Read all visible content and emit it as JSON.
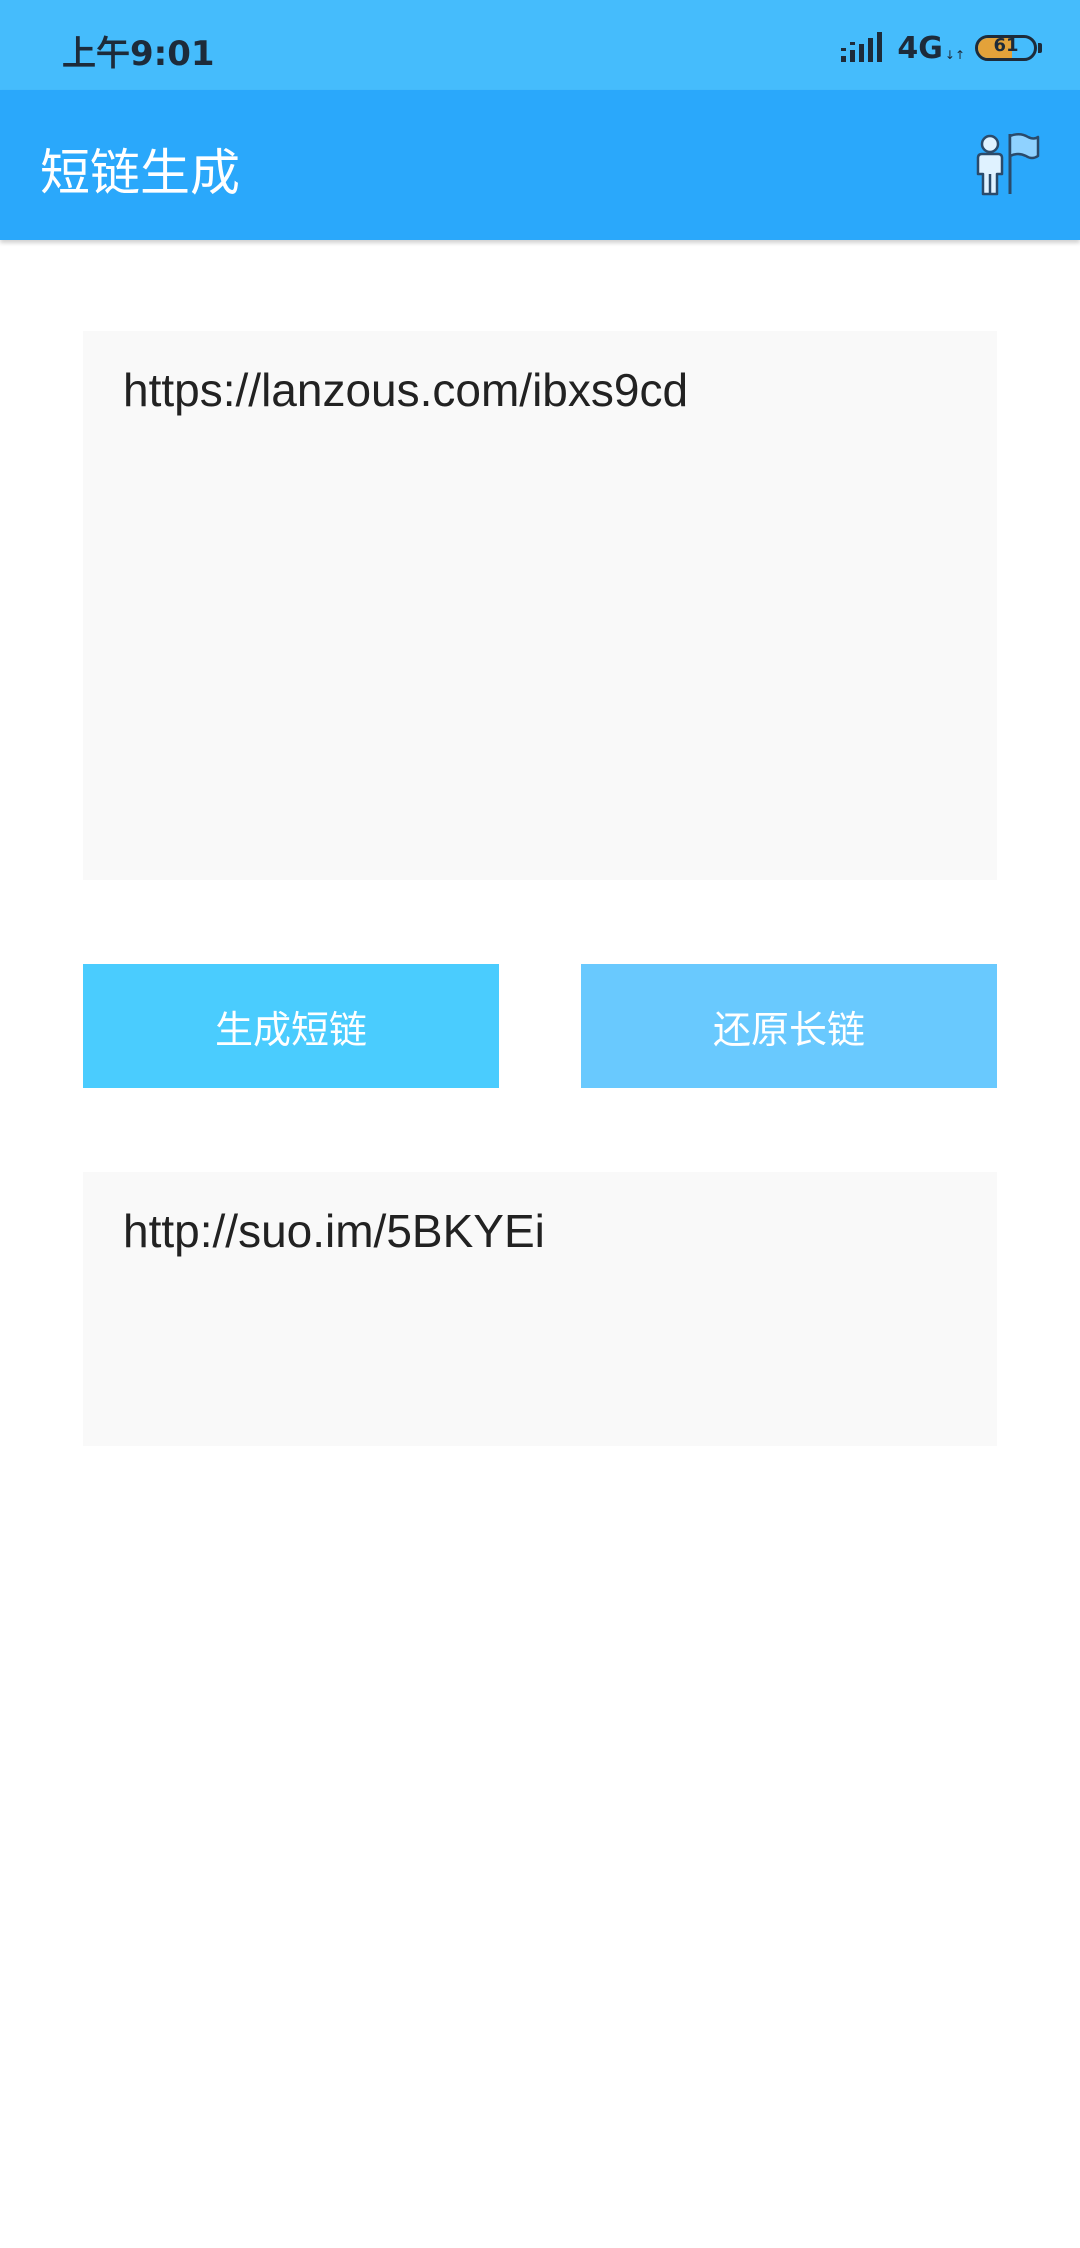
{
  "status_bar": {
    "time": "上午9:01",
    "network": "4G",
    "network_arrows": "↓↑",
    "battery_level": 61,
    "battery_text": "61",
    "background_color": "#45bcfc"
  },
  "app_bar": {
    "title": "短链生成",
    "background_color": "#2aa8fb",
    "action_icon": "person-with-flag-icon"
  },
  "input": {
    "value": "https://lanzous.com/ibxs9cd"
  },
  "buttons": {
    "generate_label": "生成短链",
    "restore_label": "还原长链",
    "generate_color": "#4accfe",
    "restore_color": "#69c9fe"
  },
  "output": {
    "value": "http://suo.im/5BKYEi"
  }
}
